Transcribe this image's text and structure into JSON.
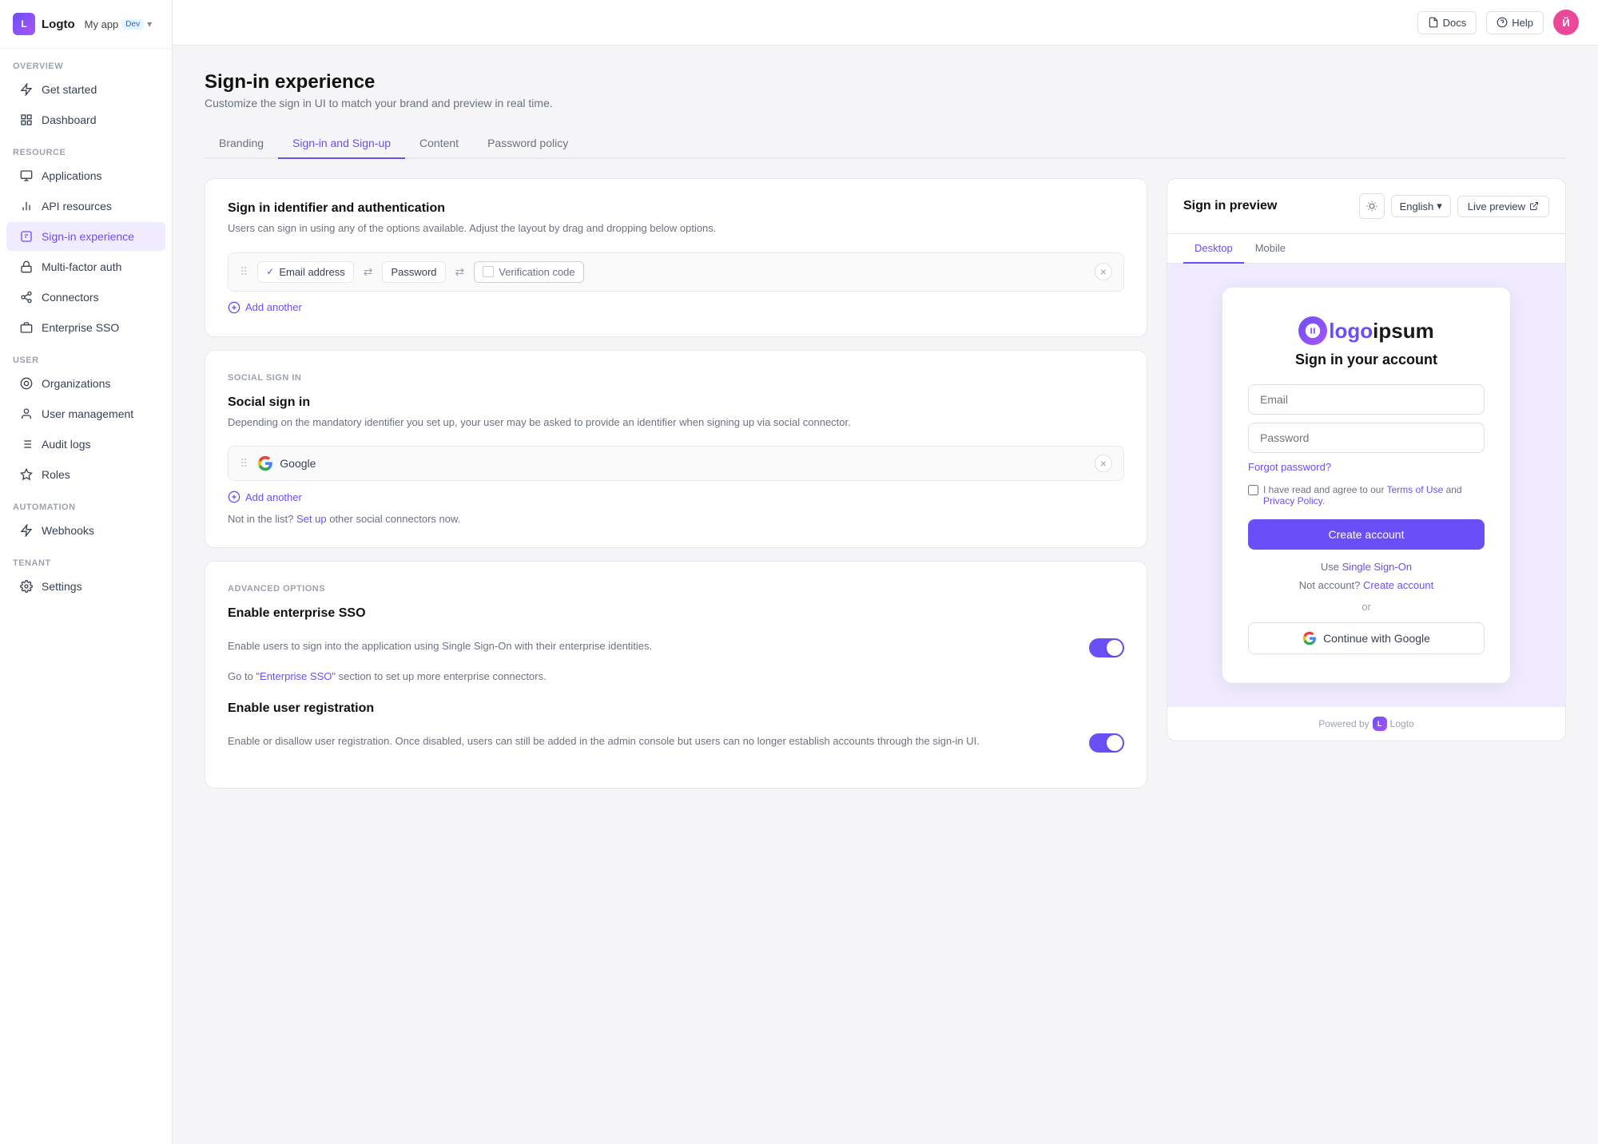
{
  "app": {
    "logo_letter": "L",
    "name": "Logto",
    "tenant": "My app",
    "env_badge": "Dev"
  },
  "topbar": {
    "docs_label": "Docs",
    "help_label": "Help",
    "user_initials": "Й"
  },
  "sidebar": {
    "overview_label": "OVERVIEW",
    "resource_label": "RESOURCE",
    "user_label": "USER",
    "automation_label": "AUTOMATION",
    "tenant_label": "TENANT",
    "items": [
      {
        "id": "get-started",
        "label": "Get started",
        "icon": "⚡"
      },
      {
        "id": "dashboard",
        "label": "Dashboard",
        "icon": "▦"
      },
      {
        "id": "applications",
        "label": "Applications",
        "icon": "⬡"
      },
      {
        "id": "api-resources",
        "label": "API resources",
        "icon": "☁"
      },
      {
        "id": "sign-in-experience",
        "label": "Sign-in experience",
        "icon": "◫",
        "active": true
      },
      {
        "id": "multi-factor-auth",
        "label": "Multi-factor auth",
        "icon": "🔒"
      },
      {
        "id": "connectors",
        "label": "Connectors",
        "icon": "⚙"
      },
      {
        "id": "enterprise-sso",
        "label": "Enterprise SSO",
        "icon": "🏢"
      },
      {
        "id": "organizations",
        "label": "Organizations",
        "icon": "◎"
      },
      {
        "id": "user-management",
        "label": "User management",
        "icon": "👤"
      },
      {
        "id": "audit-logs",
        "label": "Audit logs",
        "icon": "≡"
      },
      {
        "id": "roles",
        "label": "Roles",
        "icon": "⬡"
      },
      {
        "id": "webhooks",
        "label": "Webhooks",
        "icon": "⚡"
      },
      {
        "id": "settings",
        "label": "Settings",
        "icon": "⚙"
      }
    ]
  },
  "page": {
    "title": "Sign-in experience",
    "subtitle": "Customize the sign in UI to match your brand and preview in real time.",
    "tabs": [
      {
        "id": "branding",
        "label": "Branding"
      },
      {
        "id": "sign-in-signup",
        "label": "Sign-in and Sign-up",
        "active": true
      },
      {
        "id": "content",
        "label": "Content"
      },
      {
        "id": "password-policy",
        "label": "Password policy"
      }
    ]
  },
  "sign_in_section": {
    "title": "Sign in identifier and authentication",
    "desc": "Users can sign in using any of the options available. Adjust the layout by drag and dropping below options.",
    "identifier": "Email address",
    "method1": "Password",
    "method2": "Verification code",
    "add_another": "Add another"
  },
  "social_section": {
    "section_label": "SOCIAL SIGN IN",
    "title": "Social sign in",
    "desc": "Depending on the mandatory identifier you set up, your user may be asked to provide an identifier when signing up via social connector.",
    "connector_name": "Google",
    "add_another": "Add another",
    "not_in_list_prefix": "Not in the list?",
    "set_up_label": "Set up",
    "not_in_list_suffix": "other social connectors now."
  },
  "advanced_section": {
    "section_label": "ADVANCED OPTIONS",
    "enterprise_title": "Enable enterprise SSO",
    "enterprise_desc": "Enable users to sign into the application using Single Sign-On with their enterprise identities.",
    "enterprise_link_prefix": "Go to \"",
    "enterprise_link_label": "Enterprise SSO",
    "enterprise_link_suffix": "\" section to set up more enterprise connectors.",
    "registration_title": "Enable user registration",
    "registration_desc": "Enable or disallow user registration. Once disabled, users can still be added in the admin console but users can no longer establish accounts through the sign-in UI."
  },
  "preview": {
    "title": "Sign in preview",
    "lang": "English",
    "live_preview": "Live preview",
    "tab_desktop": "Desktop",
    "tab_mobile": "Mobile",
    "signin_heading": "Sign in your account",
    "email_placeholder": "Email",
    "password_placeholder": "Password",
    "forgot_password": "Forgot password?",
    "terms_prefix": "I have read and agree to our",
    "terms_of_use": "Terms of Use",
    "and": "and",
    "privacy_policy": "Privacy Policy",
    "create_account_btn": "Create account",
    "sso_prefix": "Use",
    "sso_link": "Single Sign-On",
    "not_account": "Not account?",
    "create_account_link": "Create account",
    "or_divider": "or",
    "google_btn": "Continue with Google",
    "powered_by": "Powered by",
    "logto": "Logto"
  }
}
